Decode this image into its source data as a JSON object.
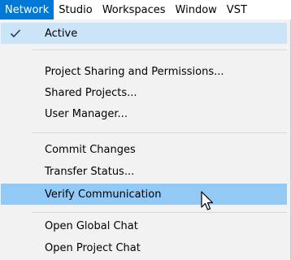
{
  "menubar": {
    "items": [
      {
        "label": "Network"
      },
      {
        "label": "Studio"
      },
      {
        "label": "Workspaces"
      },
      {
        "label": "Window"
      },
      {
        "label": "VST"
      }
    ]
  },
  "menu": {
    "items": [
      {
        "label": "Active",
        "checked": true
      },
      {
        "label": "Project Sharing and Permissions..."
      },
      {
        "label": "Shared Projects..."
      },
      {
        "label": "User Manager..."
      },
      {
        "label": "Commit Changes"
      },
      {
        "label": "Transfer Status..."
      },
      {
        "label": "Verify Communication",
        "highlighted": true
      },
      {
        "label": "Open Global Chat"
      },
      {
        "label": "Open Project Chat"
      }
    ]
  },
  "colors": {
    "menubar_active_bg": "#0078d7",
    "menu_bg": "#f2f2f2",
    "checked_bg": "#cce4f7",
    "hover_bg": "#91c9f7",
    "checkmark": "#1e3f66"
  },
  "icons": {
    "checkmark": "check-icon",
    "cursor": "mouse-pointer-icon"
  }
}
